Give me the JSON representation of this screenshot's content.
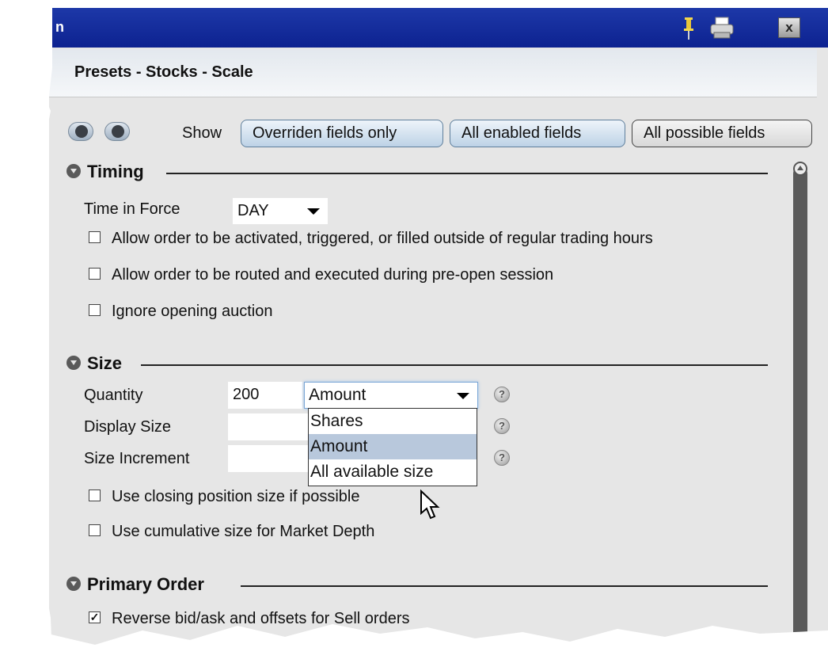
{
  "window": {
    "title_fragment": "n",
    "close_label": "x",
    "icons": {
      "pin": "pin-icon",
      "print": "print-icon",
      "close": "close-icon"
    }
  },
  "header": {
    "title": "Presets - Stocks - Scale"
  },
  "toolbar": {
    "show_label": "Show",
    "filters": [
      {
        "label": "Overriden fields only",
        "selected": false
      },
      {
        "label": "All enabled fields",
        "selected": false
      },
      {
        "label": "All possible fields",
        "selected": true
      }
    ]
  },
  "timing": {
    "title": "Timing",
    "time_in_force_label": "Time in Force",
    "time_in_force_value": "DAY",
    "options": [
      {
        "label": "Allow order to be activated, triggered, or filled outside of regular trading hours",
        "checked": false
      },
      {
        "label": "Allow order to be routed and executed during pre-open session",
        "checked": false
      },
      {
        "label": "Ignore opening auction",
        "checked": false
      }
    ]
  },
  "size": {
    "title": "Size",
    "quantity_label": "Quantity",
    "quantity_value": "200",
    "unit_selected": "Amount",
    "unit_options": [
      "Shares",
      "Amount",
      "All available size"
    ],
    "display_size_label": "Display Size",
    "size_increment_label": "Size Increment",
    "options": [
      {
        "label": "Use closing position size if possible",
        "checked": false
      },
      {
        "label": "Use cumulative size for Market Depth",
        "checked": false
      }
    ],
    "help_icon": "?"
  },
  "primary_order": {
    "title": "Primary Order",
    "options": [
      {
        "label": "Reverse bid/ask and offsets for Sell orders",
        "checked": true
      }
    ]
  },
  "colors": {
    "titlebar": "#0d2290",
    "panel": "#e6e6e6",
    "accent": "#bdd2e6"
  }
}
